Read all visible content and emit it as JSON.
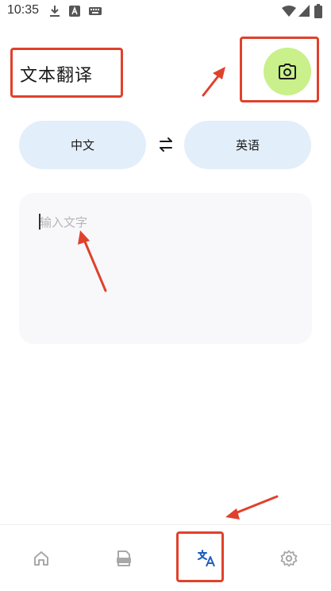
{
  "status_bar": {
    "time": "10:35",
    "icons": [
      "download-icon",
      "text-a-icon",
      "keyboard-icon",
      "wifi-icon",
      "signal-icon",
      "battery-icon"
    ]
  },
  "header": {
    "title": "文本翻译",
    "camera_icon": "camera-icon"
  },
  "languages": {
    "source": "中文",
    "target": "英语",
    "swap_icon": "swap-icon"
  },
  "input": {
    "placeholder": "输入文字",
    "value": ""
  },
  "bottom_nav": {
    "items": [
      {
        "icon": "home-icon",
        "active": false
      },
      {
        "icon": "pdf-icon",
        "active": false
      },
      {
        "icon": "translate-icon",
        "active": true
      },
      {
        "icon": "settings-icon",
        "active": false
      }
    ]
  },
  "colors": {
    "accent_green": "#c9f08a",
    "pill_blue": "#e3eefb",
    "active_nav": "#1c5fbf",
    "annotation_red": "#e0412b"
  }
}
